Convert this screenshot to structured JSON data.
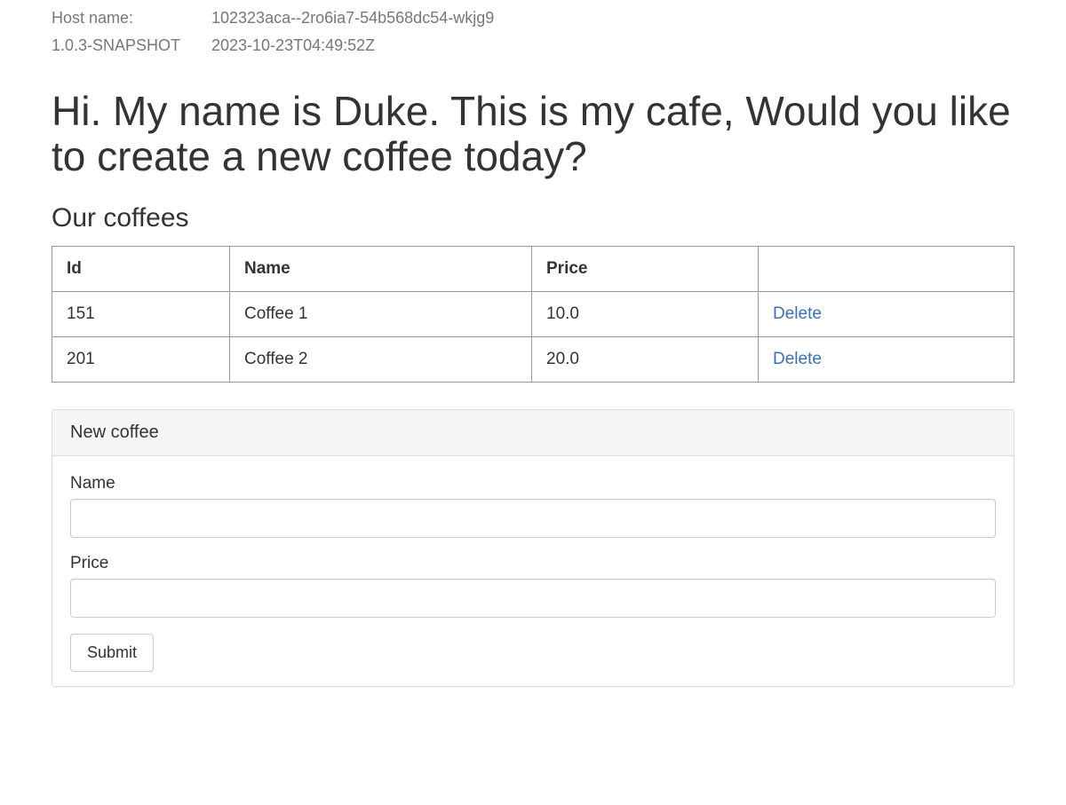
{
  "header": {
    "host_label": "Host name:",
    "host_value": "102323aca--2ro6ia7-54b568dc54-wkjg9",
    "version_label": "1.0.3-SNAPSHOT",
    "version_value": "2023-10-23T04:49:52Z"
  },
  "headline": "Hi. My name is Duke. This is my cafe, Would you like to create a new coffee today?",
  "subhead": "Our coffees",
  "table": {
    "columns": {
      "id": "Id",
      "name": "Name",
      "price": "Price",
      "action": ""
    },
    "delete_label": "Delete",
    "rows": [
      {
        "id": "151",
        "name": "Coffee 1",
        "price": "10.0"
      },
      {
        "id": "201",
        "name": "Coffee 2",
        "price": "20.0"
      }
    ]
  },
  "form": {
    "title": "New coffee",
    "name_label": "Name",
    "name_value": "",
    "price_label": "Price",
    "price_value": "",
    "submit_label": "Submit"
  }
}
